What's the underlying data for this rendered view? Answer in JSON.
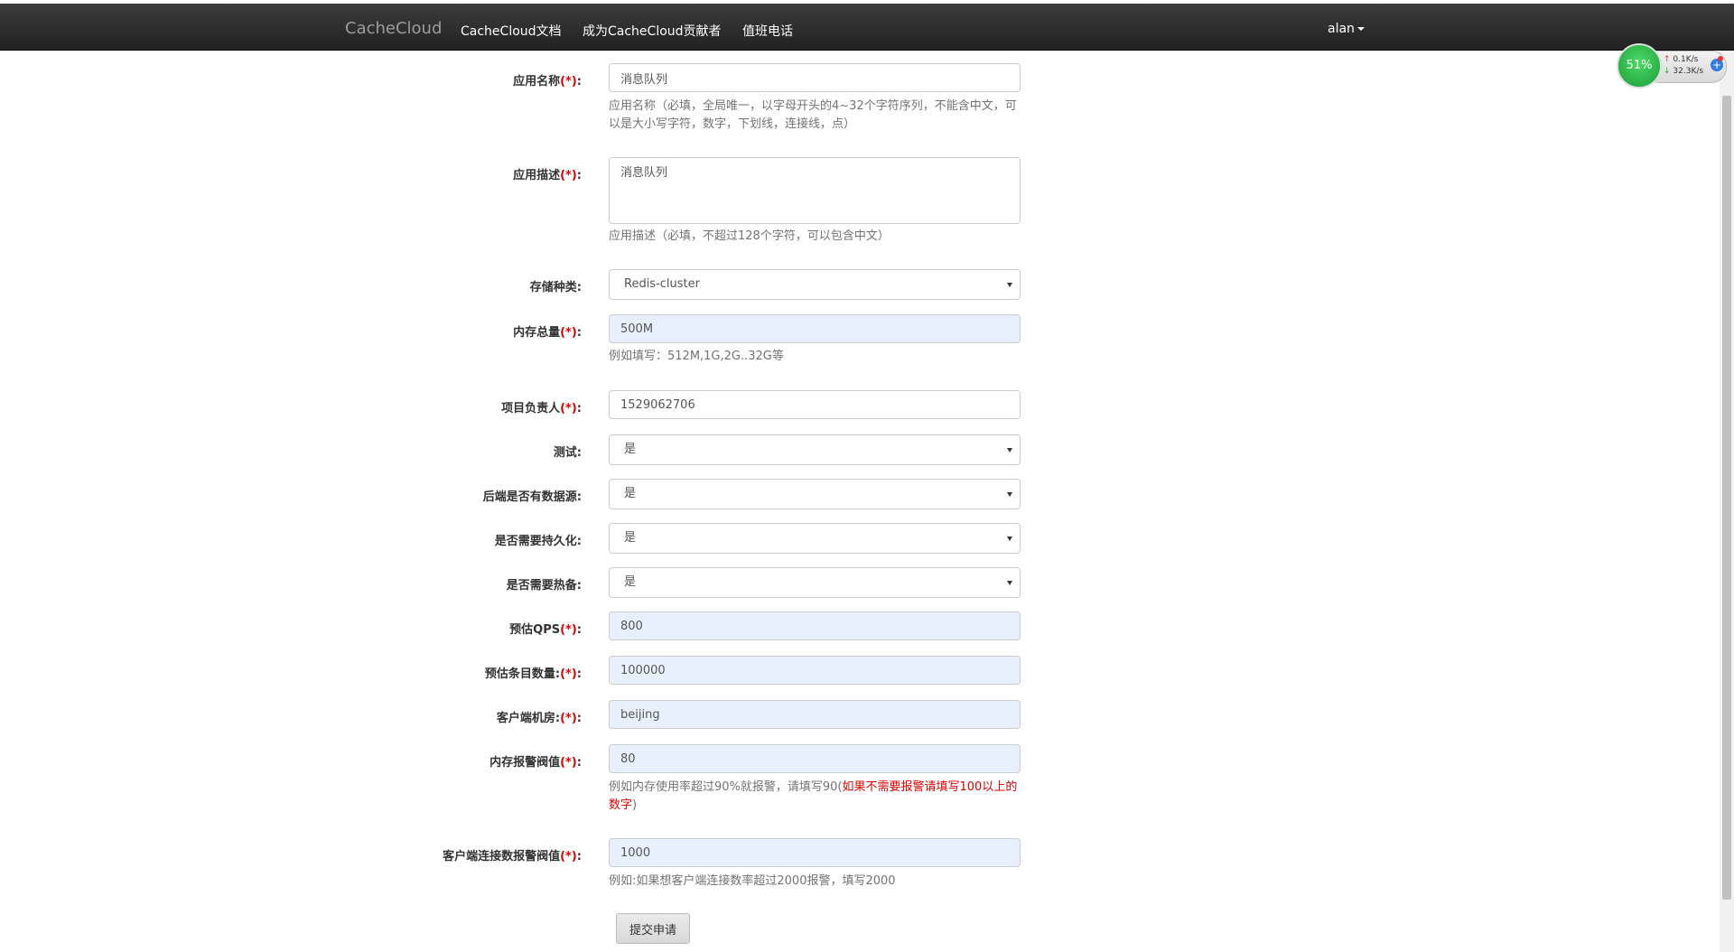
{
  "navbar": {
    "brand": "CacheCloud",
    "links": [
      "CacheCloud文档",
      "成为CacheCloud贡献者",
      "值班电话"
    ],
    "user": "alan"
  },
  "form": {
    "app_name": {
      "label": "应用名称",
      "req": "(*)",
      "colon": ":",
      "value": "消息队列",
      "help": "应用名称（必填，全局唯一，以字母开头的4~32个字符序列，不能含中文，可以是大小写字符，数字，下划线，连接线，点）"
    },
    "app_desc": {
      "label": "应用描述",
      "req": "(*)",
      "colon": ":",
      "value": "消息队列",
      "help": "应用描述（必填，不超过128个字符，可以包含中文）"
    },
    "storage_type": {
      "label": "存储种类:",
      "value": "Redis-cluster"
    },
    "memory_total": {
      "label": "内存总量",
      "req": "(*)",
      "colon": ":",
      "value": "500M",
      "help": "例如填写：512M,1G,2G..32G等"
    },
    "owner": {
      "label": "项目负责人",
      "req": "(*)",
      "colon": ":",
      "value": "1529062706"
    },
    "test": {
      "label": "测试:",
      "value": "是"
    },
    "has_backend_source": {
      "label": "后端是否有数据源:",
      "value": "是"
    },
    "need_persistence": {
      "label": "是否需要持久化:",
      "value": "是"
    },
    "need_hot_standby": {
      "label": "是否需要热备:",
      "value": "是"
    },
    "qps": {
      "label": "预估QPS",
      "req": "(*)",
      "colon": ":",
      "value": "800"
    },
    "item_count": {
      "label": "预估条目数量:",
      "req": "(*)",
      "colon": ":",
      "value": "100000"
    },
    "client_room": {
      "label": "客户端机房:",
      "req": "(*)",
      "colon": ":",
      "value": "beijing"
    },
    "memory_alert": {
      "label": "内存报警阀值",
      "req": "(*)",
      "colon": ":",
      "value": "80",
      "help": "例如内存使用率超过90%就报警，请填写90(",
      "help_warn": "如果不需要报警请填写100以上的数字",
      "help_end": ")"
    },
    "client_conn_alert": {
      "label": "客户端连接数报警阀值",
      "req": "(*)",
      "colon": ":",
      "value": "1000",
      "help": "例如:如果想客户端连接数率超过2000报警，填写2000"
    },
    "submit_label": "提交申请"
  },
  "widget": {
    "percent": "51%",
    "up": "0.1K/s",
    "down": "32.3K/s",
    "up_arrow": "↑",
    "down_arrow": "↓",
    "plus": "+"
  }
}
